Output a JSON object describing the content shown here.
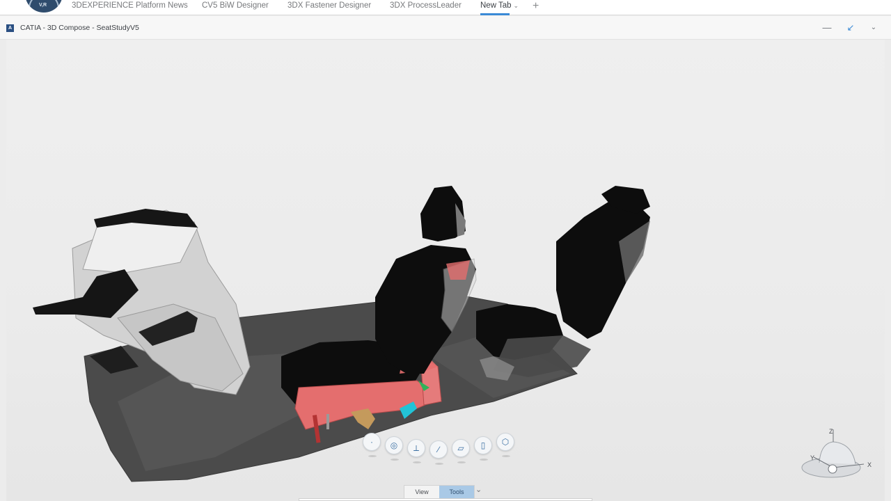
{
  "platform_tabs": [
    {
      "label": "3DEXPERIENCE Platform News"
    },
    {
      "label": "CV5 BiW Designer"
    },
    {
      "label": "3DX Fastener Designer"
    },
    {
      "label": "3DX ProcessLeader"
    },
    {
      "label": "New Tab"
    }
  ],
  "compass_label": "V,R",
  "widget": {
    "title": "CATIA - 3D Compose - SeatStudyV5",
    "icon_letter": "A"
  },
  "icons": {
    "add_tab": "plus-icon",
    "minimize": "minimize-icon",
    "collapse": "collapse-arrows-icon",
    "menu": "chevron-down-icon"
  },
  "robot_tools": [
    {
      "name": "point-tool-icon",
      "glyph": "·"
    },
    {
      "name": "target-tool-icon",
      "glyph": "◎"
    },
    {
      "name": "axis-system-tool-icon",
      "glyph": "⟂"
    },
    {
      "name": "line-tool-icon",
      "glyph": "∕"
    },
    {
      "name": "plane-tool-icon",
      "glyph": "▱"
    },
    {
      "name": "cylinder-tool-icon",
      "glyph": "▯"
    },
    {
      "name": "box-tool-icon",
      "glyph": "⬡"
    }
  ],
  "action_bar": {
    "tabs": [
      {
        "label": "View"
      },
      {
        "label": "Tools"
      }
    ],
    "active": "Tools"
  },
  "compass_axes": {
    "x": "X",
    "y": "Y",
    "z": "Z"
  },
  "colors": {
    "accent": "#3a8ad6",
    "seat_red": "#e46e6e",
    "seat_black": "#0d0d0d",
    "floor_gray": "#4a4a4a"
  }
}
